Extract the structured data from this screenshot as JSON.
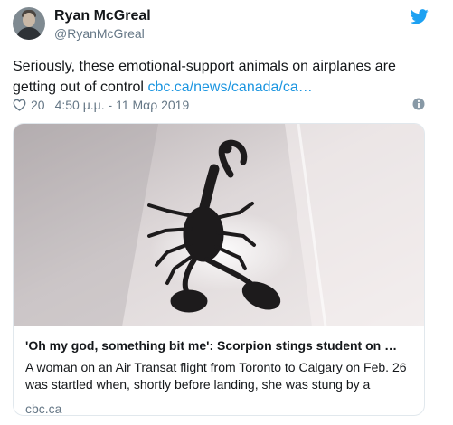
{
  "user": {
    "name": "Ryan McGreal",
    "handle": "@RyanMcGreal"
  },
  "tweet": {
    "text": "Seriously, these emotional-support animals on airplanes are getting out of control ",
    "link_text": "cbc.ca/news/canada/ca…",
    "like_count": "20",
    "timestamp": "4:50 μ.μ. - 11 Μαρ 2019"
  },
  "card": {
    "title": "'Oh my god, something bit me': Scorpion stings student on …",
    "description": "A woman on an Air Transat flight from Toronto to Calgary on Feb. 26 was startled when, shortly before landing, she was stung by a",
    "domain": "cbc.ca"
  },
  "icons": {
    "brand": "twitter-bird-icon",
    "like": "heart-icon",
    "info": "info-icon"
  },
  "colors": {
    "twitter_blue": "#1da1f2",
    "link": "#1b95e0",
    "secondary_text": "#657786",
    "border": "#e1e8ed"
  }
}
